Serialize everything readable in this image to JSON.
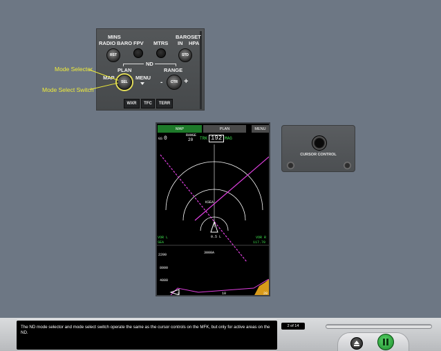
{
  "efis": {
    "mins": "MINS",
    "radio": "RADIO",
    "baro": "BARO",
    "fpv": "FPV",
    "mtrs": "MTRS",
    "baroset": "BAROSET",
    "in": "IN",
    "hpa": "HPA",
    "rst": "RST",
    "std": "STD",
    "nd": "ND",
    "plan": "PLAN",
    "map": "MAP",
    "sel": "SEL",
    "menu": "MENU",
    "range": "RANGE",
    "ctr": "CTR",
    "minus": "-",
    "plus": "+",
    "wxr": "WXR",
    "tfc": "TFC",
    "terr": "TERR"
  },
  "callouts": {
    "mode_selector": "Mode Selector",
    "mode_select_switch": "Mode Select Switch"
  },
  "nd": {
    "tab_map": "MAP",
    "tab_plan": "PLAN",
    "tab_menu": "MENU",
    "gs_label": "GS",
    "gs_value": "0",
    "range_label": "RANGE",
    "range_value": "20",
    "trk_label": "TRK",
    "heading": "192",
    "mag_label": "MAG",
    "vor_l": "VOR L",
    "vor_r": "VOR R",
    "freq_r": "117.70",
    "bottom_left": "SEA",
    "range_half": "0.5 L",
    "alt_1": "2200",
    "alt_2": "8000",
    "alt_3": "4000",
    "x_0": "0",
    "x_10": "10",
    "x_20": "20",
    "wpt_label": "KSEA",
    "wpt_alt": "3000A"
  },
  "cursor_control": {
    "label": "CURSOR CONTROL"
  },
  "footer": {
    "caption": "The ND mode selector and mode select switch operate the same as the cursor controls on the MFK, but only for active areas on the ND.",
    "page": "2 of 14"
  },
  "colors": {
    "background": "#6d7784",
    "callout": "#f0ec3a",
    "nd_green": "#3fe04f",
    "nd_magenta": "#e040e0",
    "nd_cyan": "#44d8e8",
    "play_button": "#27b83a"
  },
  "icons": {
    "eject": "eject-icon",
    "pause": "pause-icon"
  }
}
